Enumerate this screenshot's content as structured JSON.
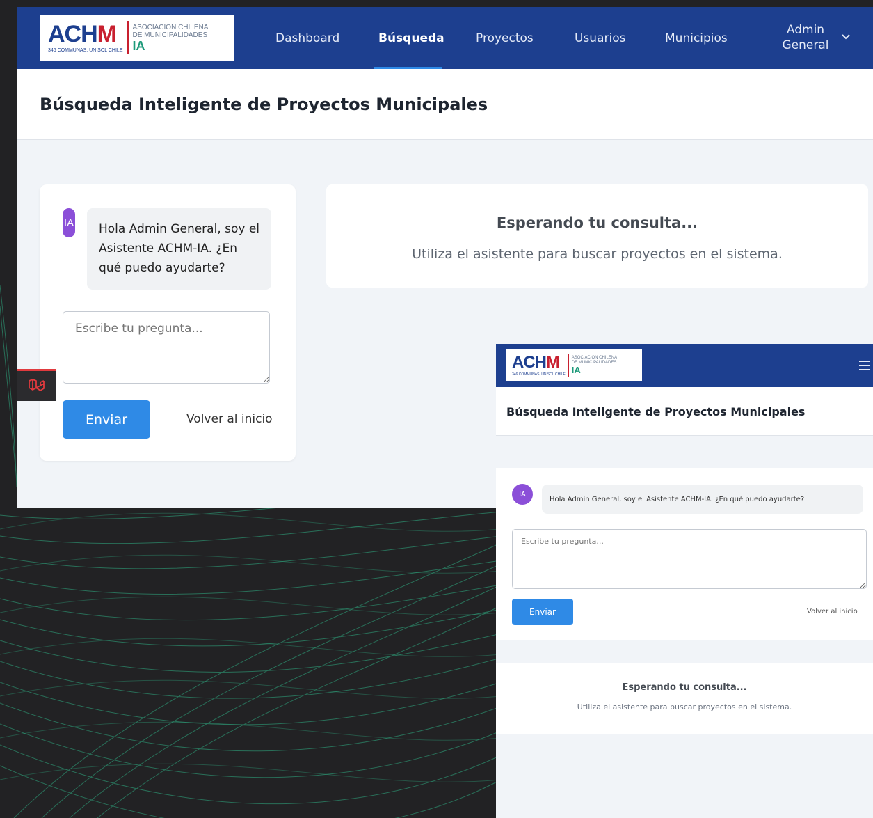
{
  "brand": {
    "logo_word_a": "ACH",
    "logo_word_m": "M",
    "logo_tagline": "346 COMMUNAS, UN SOL CHILE",
    "logo_org_line1": "ASOCIACION CHILENA",
    "logo_org_line2": "DE MUNICIPALIDADES",
    "logo_ia": "IA",
    "colors": {
      "nav": "#1d3f8f",
      "accent": "#2f8ae6",
      "avatar": "#8b4fd8",
      "logo_red": "#c8202f",
      "logo_green": "#1d9a7a"
    }
  },
  "nav": {
    "items": [
      {
        "label": "Dashboard"
      },
      {
        "label": "Búsqueda"
      },
      {
        "label": "Proyectos"
      },
      {
        "label": "Usuarios"
      },
      {
        "label": "Municipios"
      }
    ],
    "user_line1": "Admin",
    "user_line2": "General",
    "dropdown_icon": "chevron-down-icon",
    "mobile_menu_icon": "hamburger-icon"
  },
  "page": {
    "title": "Búsqueda Inteligente de Proyectos Municipales"
  },
  "chat": {
    "avatar_label": "IA",
    "greeting": "Hola Admin General, soy el Asistente ACHM-IA. ¿En qué puedo ayudarte?",
    "input_placeholder": "Escribe tu pregunta...",
    "send_label": "Enviar",
    "back_label": "Volver al inicio"
  },
  "results": {
    "waiting_title": "Esperando tu consulta...",
    "waiting_subtitle": "Utiliza el asistente para buscar proyectos en el sistema."
  },
  "debug_bar": {
    "icon": "laravel-icon"
  }
}
